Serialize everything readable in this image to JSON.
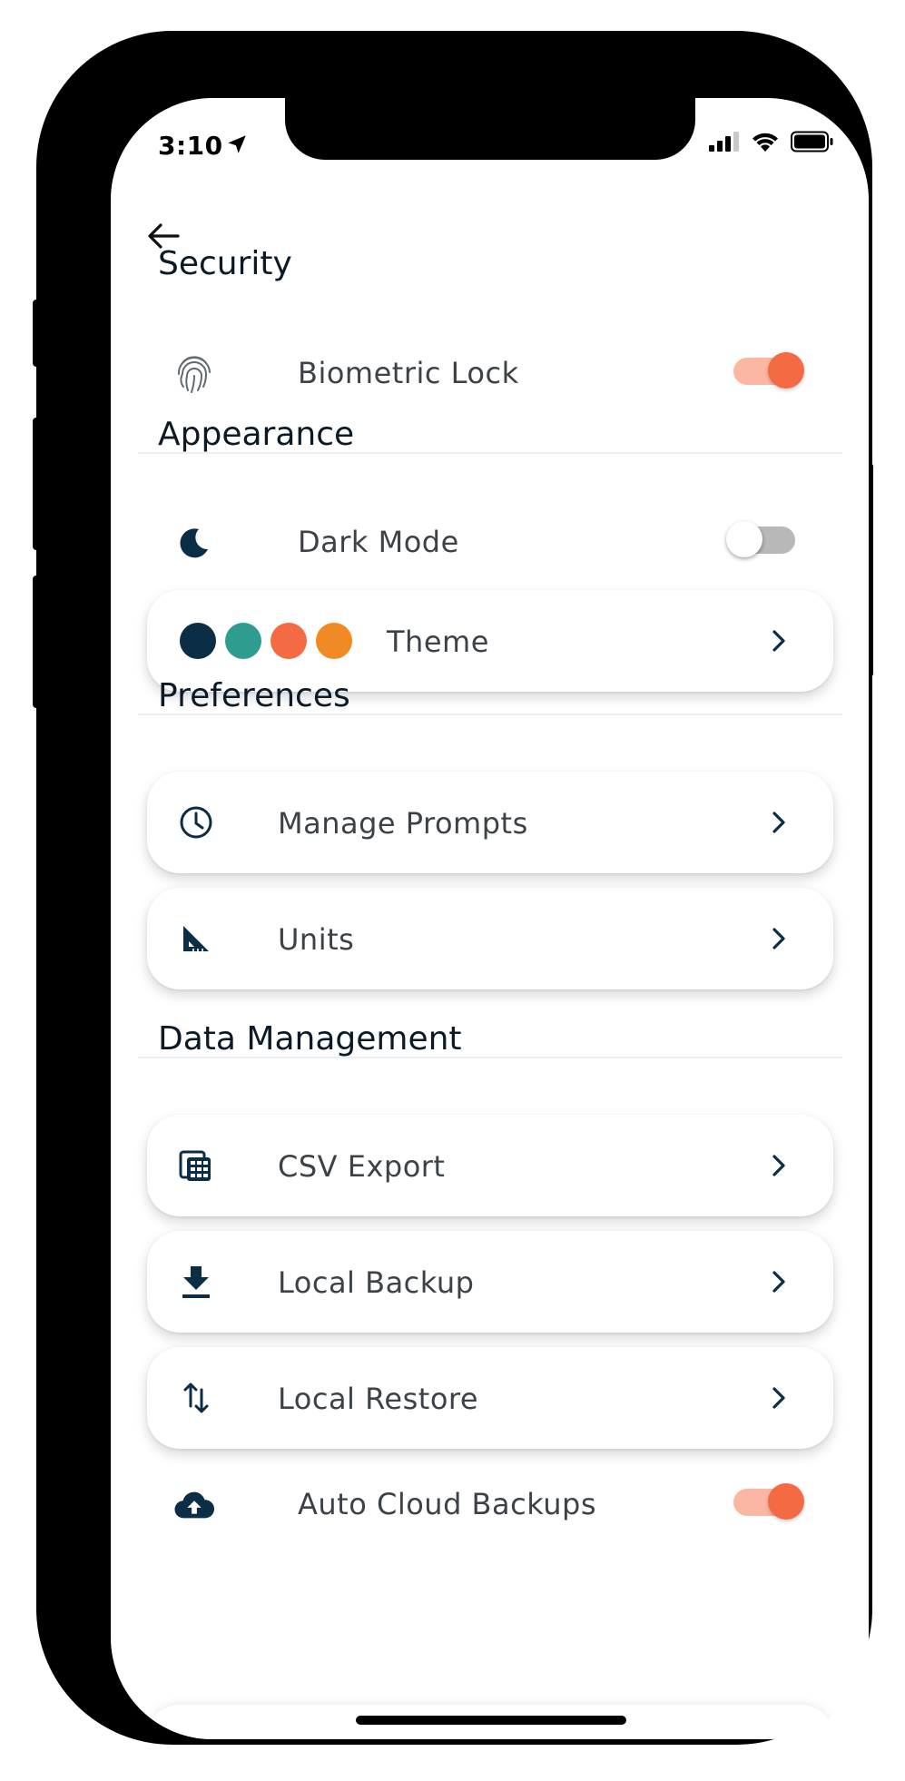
{
  "status": {
    "time": "3:10"
  },
  "colors": {
    "accent": "#f36a43",
    "accent_light": "#fbb7a3",
    "icon": "#0b2d45",
    "text": "#3c4248"
  },
  "sections": {
    "security": {
      "title": "Security",
      "biometric": {
        "label": "Biometric Lock",
        "icon": "fingerprint-icon",
        "enabled": true
      }
    },
    "appearance": {
      "title": "Appearance",
      "dark_mode": {
        "label": "Dark Mode",
        "icon": "moon-icon",
        "enabled": false
      },
      "theme": {
        "label": "Theme",
        "swatches": [
          "#0b2d45",
          "#2e9d8f",
          "#f36a43",
          "#f08a24"
        ]
      }
    },
    "preferences": {
      "title": "Preferences",
      "manage_prompts": {
        "label": "Manage Prompts",
        "icon": "clock-icon"
      },
      "units": {
        "label": "Units",
        "icon": "ruler-triangle-icon"
      }
    },
    "data_management": {
      "title": "Data Management",
      "csv_export": {
        "label": "CSV Export",
        "icon": "calculator-icon"
      },
      "local_backup": {
        "label": "Local Backup",
        "icon": "download-icon"
      },
      "local_restore": {
        "label": "Local Restore",
        "icon": "swap-vertical-icon"
      },
      "auto_cloud": {
        "label": "Auto Cloud Backups",
        "icon": "cloud-upload-icon",
        "enabled": true
      }
    }
  }
}
